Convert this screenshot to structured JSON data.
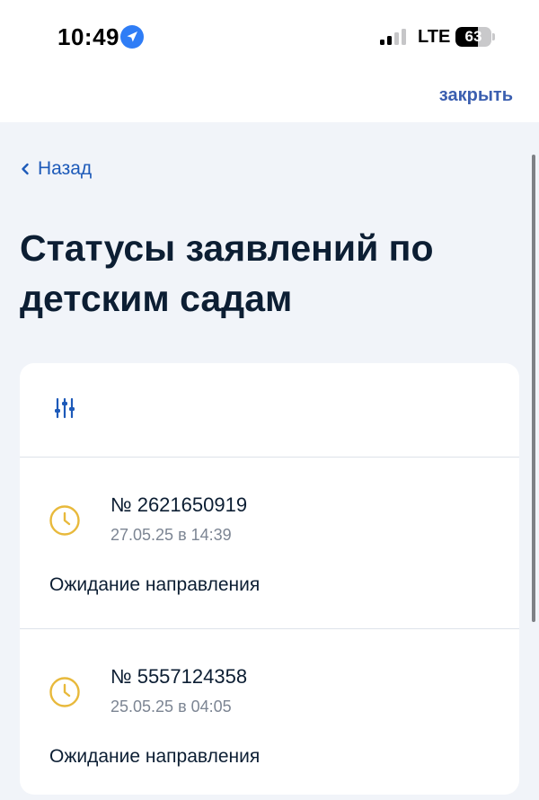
{
  "status_bar": {
    "time": "10:49",
    "network": "LTE",
    "battery_level": "63",
    "battery_fraction": 0.63,
    "signal_bars_active": 2,
    "signal_bars_total": 4
  },
  "top_bar": {
    "close_label": "закрыть"
  },
  "navigation": {
    "back_label": "Назад"
  },
  "page": {
    "title": "Статусы заявлений по детским садам"
  },
  "applications": [
    {
      "number": "№ 2621650919",
      "date": "27.05.25 в 14:39",
      "status": "Ожидание направления",
      "status_icon": "clock-icon"
    },
    {
      "number": "№ 5557124358",
      "date": "25.05.25 в 04:05",
      "status": "Ожидание направления",
      "status_icon": "clock-icon"
    }
  ],
  "colors": {
    "accent": "#1d5ab9",
    "pending": "#e8b93b",
    "title": "#0c1e33",
    "muted": "#7c8593",
    "background": "#f1f4f9"
  }
}
